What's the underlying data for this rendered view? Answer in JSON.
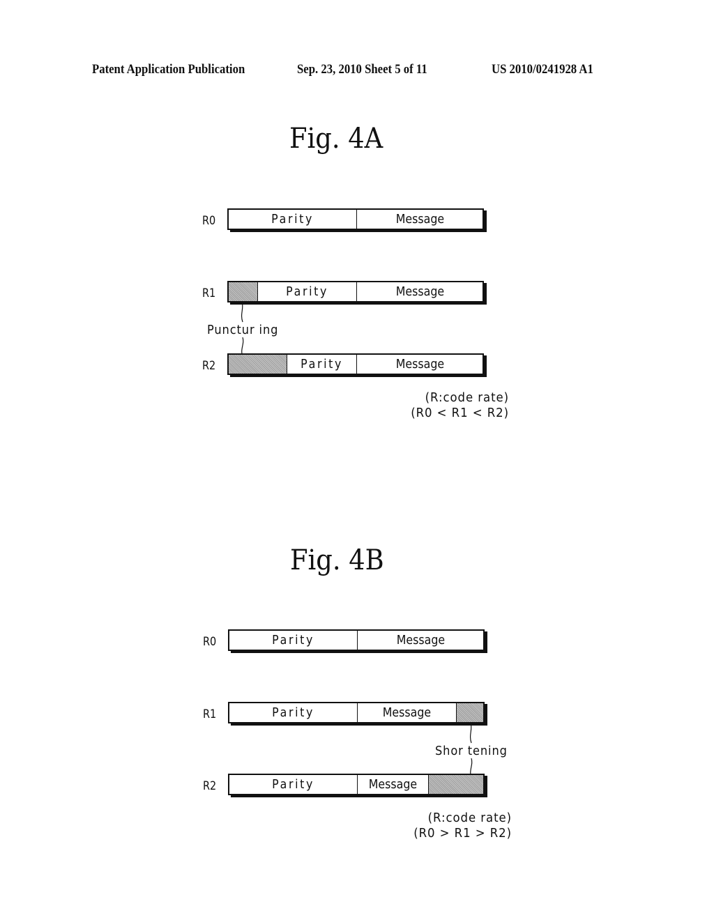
{
  "header": {
    "publication": "Patent Application Publication",
    "date_sheet": "Sep. 23, 2010   Sheet 5 of 11",
    "number": "US 2010/0241928 A1"
  },
  "fig4a": {
    "title": "Fig.  4A",
    "rows": [
      {
        "label": "R0",
        "segments": [
          {
            "type": "text",
            "label": "Parity"
          },
          {
            "type": "text",
            "label": "Message"
          }
        ]
      },
      {
        "label": "R1",
        "segments": [
          {
            "type": "hatched",
            "label": ""
          },
          {
            "type": "text",
            "label": "Parity"
          },
          {
            "type": "text",
            "label": "Message"
          }
        ]
      },
      {
        "label": "R2",
        "segments": [
          {
            "type": "hatched",
            "label": ""
          },
          {
            "type": "text",
            "label": "Parity"
          },
          {
            "type": "text",
            "label": "Message"
          }
        ]
      }
    ],
    "annotation": "Punctur ing",
    "note_line1": "(R:code rate)",
    "note_line2": "(R0 < R1 < R2)"
  },
  "fig4b": {
    "title": "Fig.  4B",
    "rows": [
      {
        "label": "R0",
        "segments": [
          {
            "type": "text",
            "label": "Parity"
          },
          {
            "type": "text",
            "label": "Message"
          }
        ]
      },
      {
        "label": "R1",
        "segments": [
          {
            "type": "text",
            "label": "Parity"
          },
          {
            "type": "text",
            "label": "Message"
          },
          {
            "type": "hatched",
            "label": ""
          }
        ]
      },
      {
        "label": "R2",
        "segments": [
          {
            "type": "text",
            "label": "Parity"
          },
          {
            "type": "text",
            "label": "Message"
          },
          {
            "type": "hatched",
            "label": ""
          }
        ]
      }
    ],
    "annotation": "Shor tening",
    "note_line1": "(R:code rate)",
    "note_line2": "(R0 > R1 > R2)"
  }
}
